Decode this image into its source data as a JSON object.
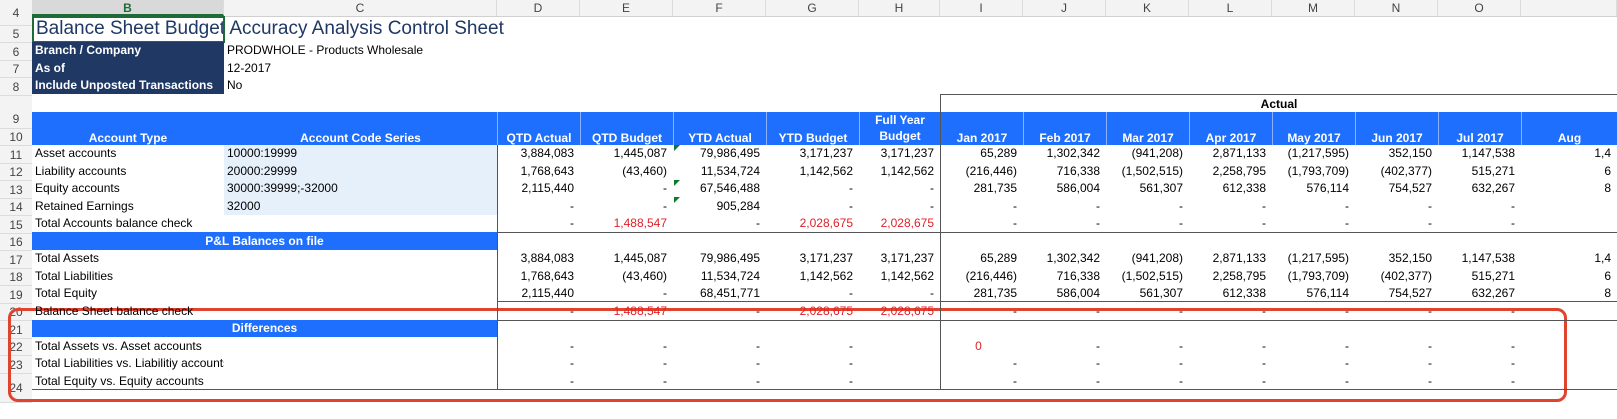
{
  "title": "Balance Sheet Budget Accuracy Analysis Control Sheet",
  "column_headers": [
    "B",
    "C",
    "D",
    "E",
    "F",
    "G",
    "H",
    "I",
    "J",
    "K",
    "L",
    "M",
    "N",
    "O"
  ],
  "row_numbers": [
    "4",
    "5",
    "6",
    "7",
    "8",
    "9",
    "10",
    "11",
    "12",
    "13",
    "14",
    "15",
    "16",
    "17",
    "18",
    "19",
    "20",
    "21",
    "22",
    "23",
    "24"
  ],
  "params": [
    {
      "label": "Branch / Company",
      "value": "PRODWHOLE - Products Wholesale"
    },
    {
      "label": "As of",
      "value": "12-2017"
    },
    {
      "label": "Include Unposted Transactions",
      "value": "No"
    }
  ],
  "actual_label": "Actual",
  "headers": {
    "account_type": "Account Type",
    "account_code": "Account Code Series",
    "qtd_actual": "QTD Actual",
    "qtd_budget": "QTD Budget",
    "ytd_actual": "YTD Actual",
    "ytd_budget": "YTD Budget",
    "full_year_1": "Full Year",
    "full_year_2": "Budget",
    "months": [
      "Jan 2017",
      "Feb 2017",
      "Mar 2017",
      "Apr 2017",
      "May 2017",
      "Jun 2017",
      "Jul 2017",
      "Aug"
    ]
  },
  "section1_rows": [
    {
      "label": "Asset accounts",
      "code": "10000:19999",
      "vals": [
        "3,884,083",
        "1,445,087",
        "79,986,495",
        "3,171,237",
        "3,171,237"
      ],
      "months": [
        "65,289",
        "1,302,342",
        "(941,208)",
        "2,871,133",
        "(1,217,595)",
        "352,150",
        "1,147,538",
        "1,4"
      ]
    },
    {
      "label": "Liability accounts",
      "code": "20000:29999",
      "vals": [
        "1,768,643",
        "(43,460)",
        "11,534,724",
        "1,142,562",
        "1,142,562"
      ],
      "months": [
        "(216,446)",
        "716,338",
        "(1,502,515)",
        "2,258,795",
        "(1,793,709)",
        "(402,377)",
        "515,271",
        "6"
      ]
    },
    {
      "label": "Equity accounts",
      "code": "30000:39999;-32000",
      "vals": [
        "2,115,440",
        "-",
        "67,546,488",
        "-",
        "-"
      ],
      "months": [
        "281,735",
        "586,004",
        "561,307",
        "612,338",
        "576,114",
        "754,527",
        "632,267",
        "8"
      ]
    },
    {
      "label": "Retained Earnings",
      "code": "32000",
      "vals": [
        "-",
        "-",
        "905,284",
        "-",
        "-"
      ],
      "months": [
        "-",
        "-",
        "-",
        "-",
        "-",
        "-",
        "-",
        ""
      ]
    },
    {
      "label": "Total Accounts balance check",
      "code": "",
      "vals": [
        "-",
        "1,488,547",
        "-",
        "2,028,675",
        "2,028,675"
      ],
      "months": [
        "-",
        "-",
        "-",
        "-",
        "-",
        "-",
        "-",
        ""
      ]
    }
  ],
  "pl_header": "P&L Balances on file",
  "section2_rows": [
    {
      "label": "Total Assets",
      "vals": [
        "3,884,083",
        "1,445,087",
        "79,986,495",
        "3,171,237",
        "3,171,237"
      ],
      "months": [
        "65,289",
        "1,302,342",
        "(941,208)",
        "2,871,133",
        "(1,217,595)",
        "352,150",
        "1,147,538",
        "1,4"
      ]
    },
    {
      "label": "Total Liabilities",
      "vals": [
        "1,768,643",
        "(43,460)",
        "11,534,724",
        "1,142,562",
        "1,142,562"
      ],
      "months": [
        "(216,446)",
        "716,338",
        "(1,502,515)",
        "2,258,795",
        "(1,793,709)",
        "(402,377)",
        "515,271",
        "6"
      ]
    },
    {
      "label": "Total Equity",
      "vals": [
        "2,115,440",
        "-",
        "68,451,771",
        "-",
        "-"
      ],
      "months": [
        "281,735",
        "586,004",
        "561,307",
        "612,338",
        "576,114",
        "754,527",
        "632,267",
        "8"
      ]
    },
    {
      "label": "Balance Sheet balance check",
      "vals": [
        "-",
        "1,488,547",
        "-",
        "2,028,675",
        "2,028,675"
      ],
      "months": [
        "-",
        "-",
        "-",
        "-",
        "-",
        "-",
        "-",
        ""
      ]
    }
  ],
  "diff_header": "Differences",
  "section3_rows": [
    {
      "label": "Total Assets vs. Asset accounts",
      "vals": [
        "-",
        "-",
        "-",
        "-"
      ],
      "months": [
        "0",
        "-",
        "-",
        "-",
        "-",
        "-",
        "-",
        ""
      ]
    },
    {
      "label": "Total Liabilities vs. Liabilitiy accounts",
      "vals": [
        "-",
        "-",
        "-",
        "-"
      ],
      "months": [
        "-",
        "-",
        "-",
        "-",
        "-",
        "-",
        "-",
        ""
      ]
    },
    {
      "label": "Total Equity vs. Equity accounts",
      "vals": [
        "-",
        "-",
        "-",
        "-"
      ],
      "months": [
        "-",
        "-",
        "-",
        "-",
        "-",
        "-",
        "-",
        ""
      ]
    }
  ],
  "colors": {
    "dark_blue": "#1f3864",
    "blue": "#1f6fff",
    "light_blue": "#e6f0fb",
    "red": "#e0202a",
    "callout": "#e0442f"
  }
}
